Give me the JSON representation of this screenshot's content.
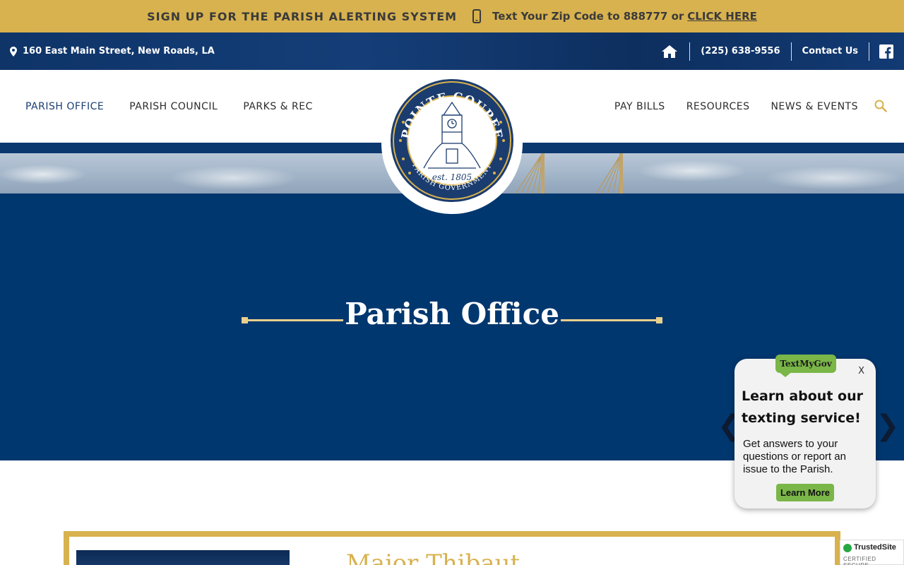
{
  "alert_bar": {
    "title": "SIGN UP FOR THE PARISH ALERTING SYSTEM",
    "text": "Text Your Zip Code to 888777 or",
    "link": "CLICK HERE"
  },
  "info_bar": {
    "address": "160 East Main Street, New Roads, LA",
    "phone": "(225) 638-9556",
    "contact": "Contact Us"
  },
  "nav": {
    "left": [
      "PARISH OFFICE",
      "PARISH COUNCIL",
      "PARKS & REC"
    ],
    "right": [
      "PAY BILLS",
      "RESOURCES",
      "NEWS & EVENTS"
    ]
  },
  "logo": {
    "top_text": "POINTE COUPEE",
    "est": "est. 1805",
    "bottom_text": "PARISH GOVERNMENT"
  },
  "hero": {
    "title": "Parish Office",
    "prev_arrow": "❮",
    "next_arrow": "❯"
  },
  "widget": {
    "badge": "TextMyGov",
    "close": "X",
    "heading": "Learn about our texting service!",
    "body": "Get answers to your questions or report an issue to the Parish.",
    "button": "Learn More"
  },
  "content": {
    "name": "Major Thibaut"
  },
  "trusted": {
    "title": "TrustedSite",
    "subtitle": "CERTIFIED SECURE"
  },
  "colors": {
    "gold": "#d8b24f",
    "navy": "#00376f",
    "green": "#7ab648"
  }
}
